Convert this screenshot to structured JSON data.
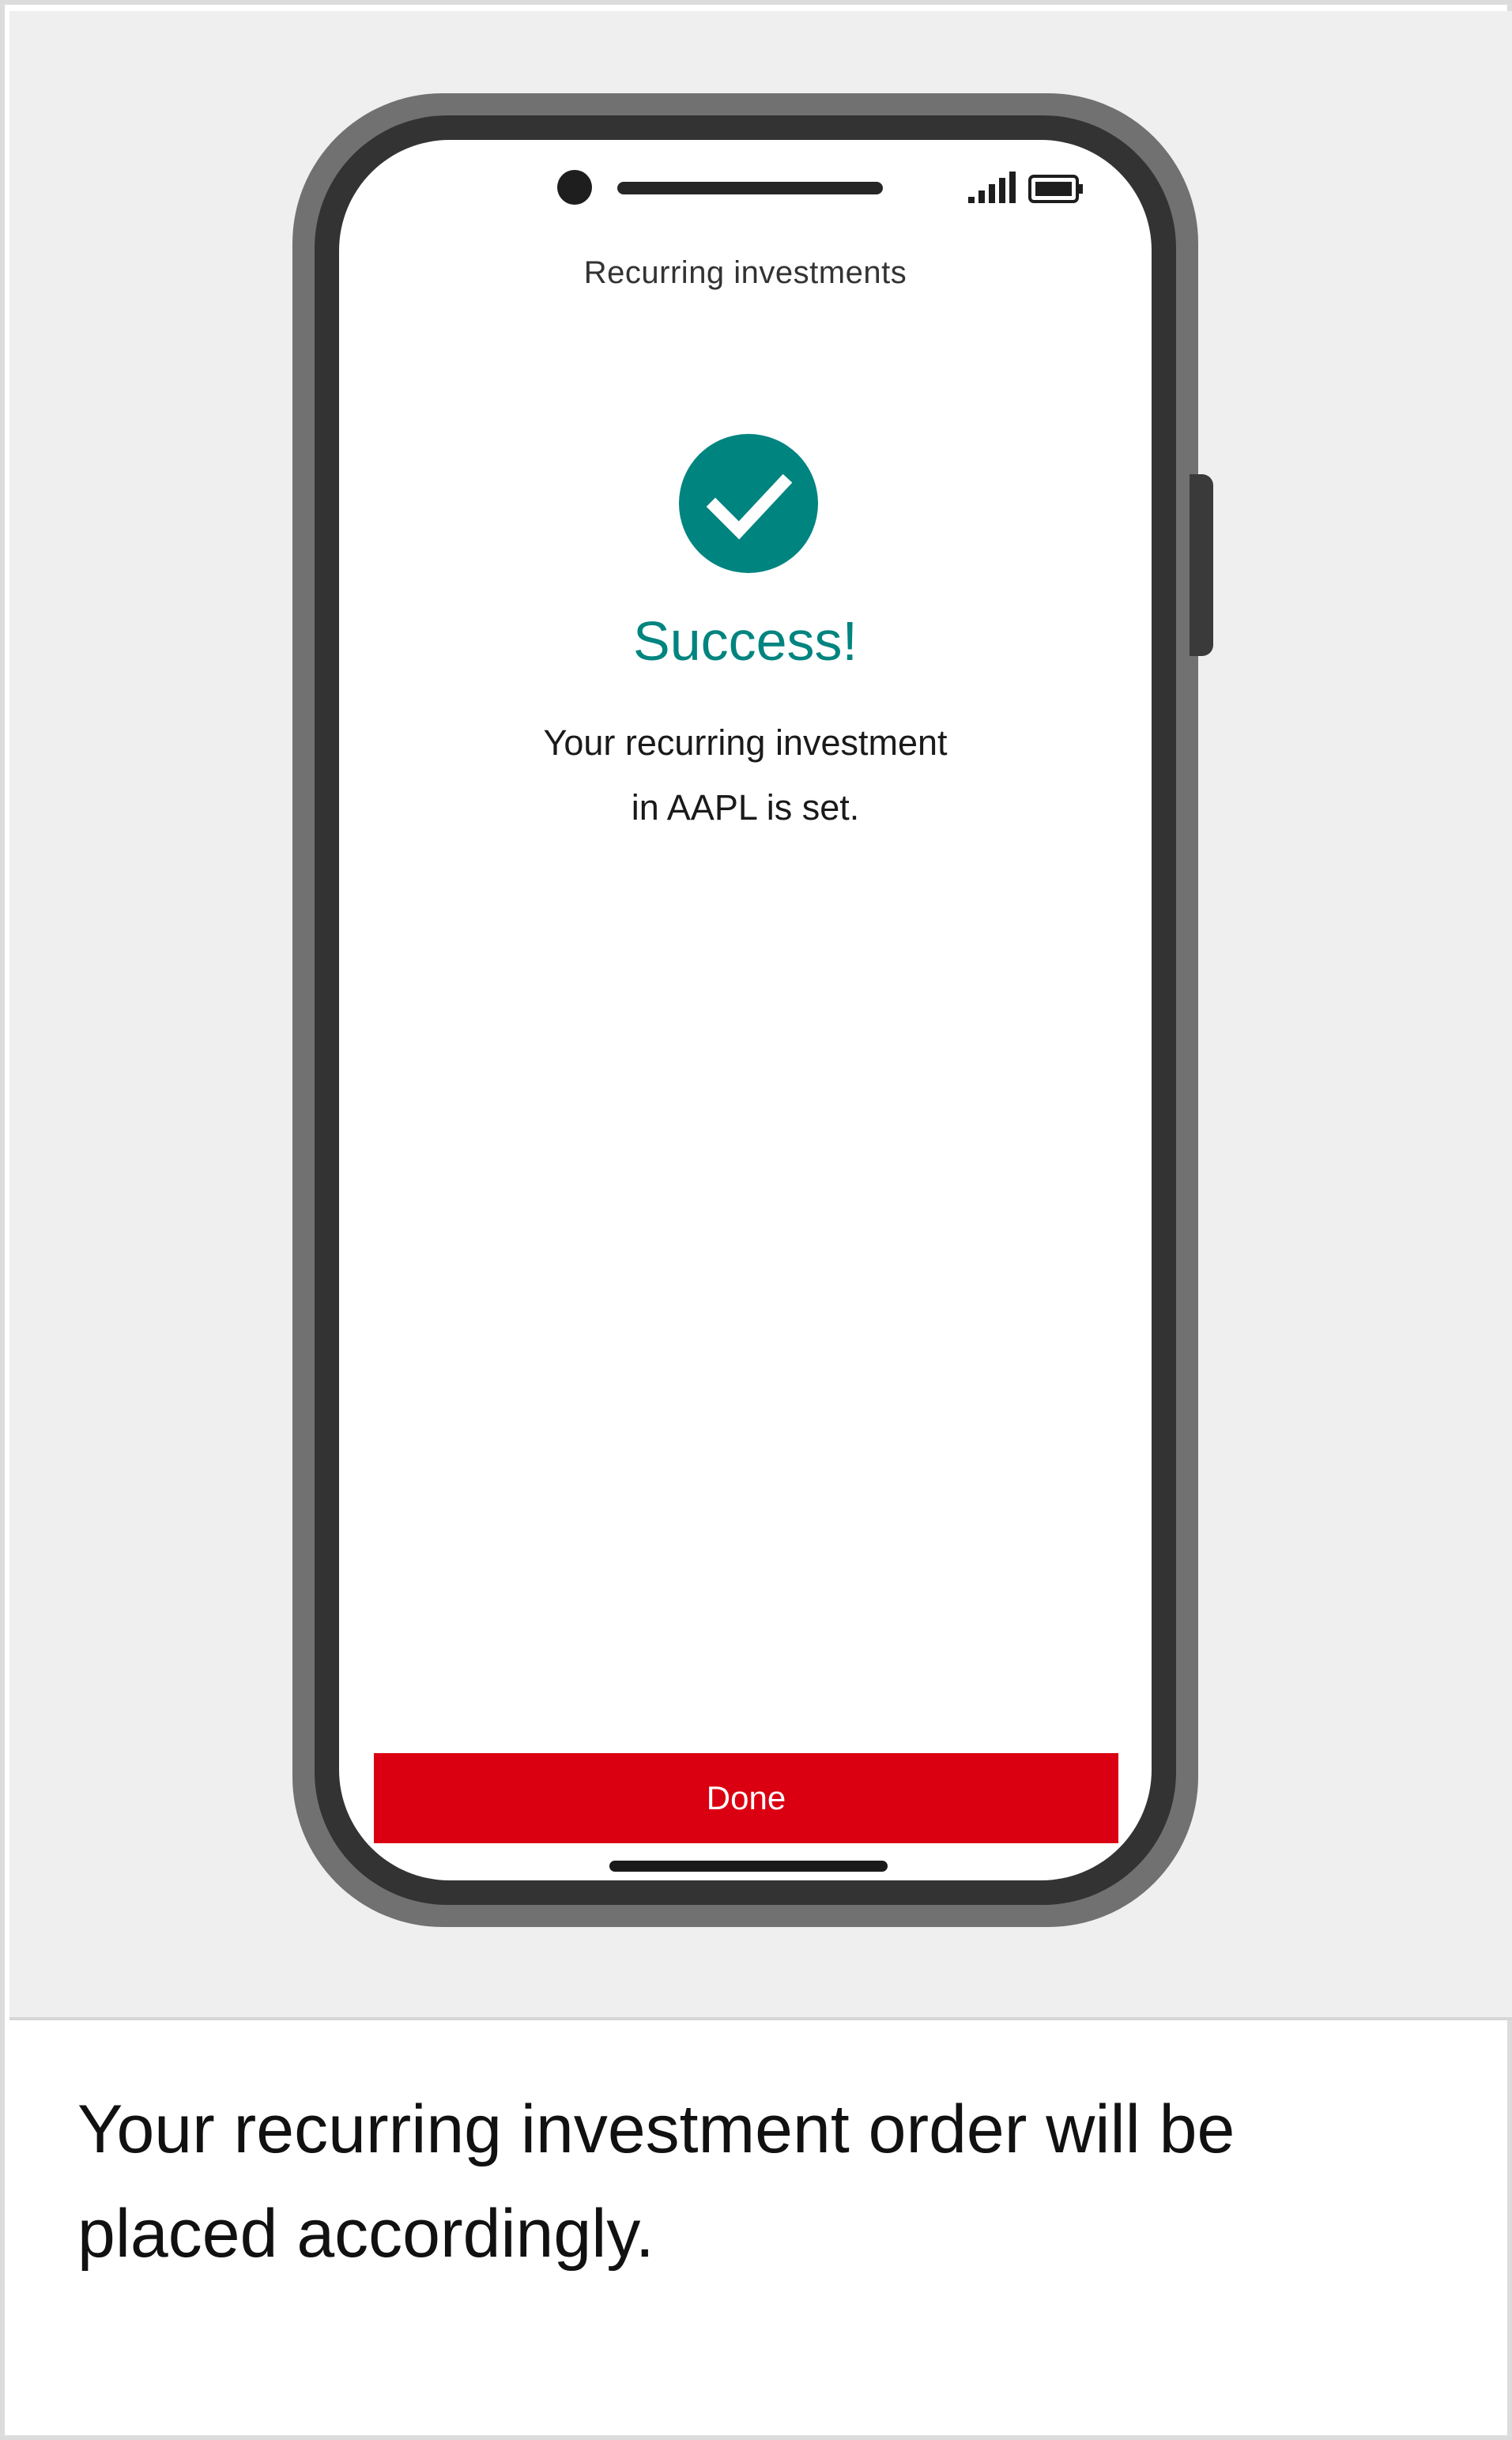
{
  "screen": {
    "header_title": "Recurring investments",
    "status_icons": [
      "signal-icon",
      "battery-icon"
    ],
    "success_icon": "checkmark-circle-icon",
    "success_title": "Success!",
    "message_line1": "Your recurring investment",
    "message_line2": "in AAPL is set.",
    "done_label": "Done"
  },
  "caption": {
    "text": "Your recurring investment order will be placed accordingly."
  },
  "colors": {
    "accent_teal": "#00847f",
    "button_red": "#db0011",
    "background": "#efefef"
  }
}
